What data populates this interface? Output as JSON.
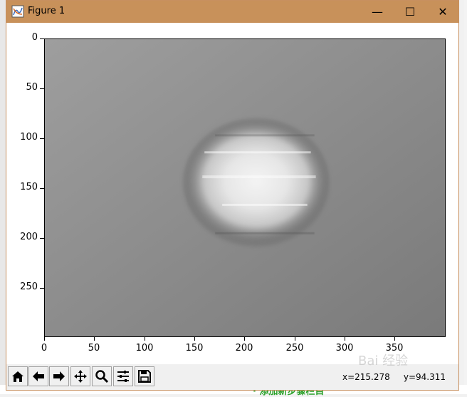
{
  "window": {
    "title": "Figure 1",
    "controls": {
      "minimize": "—",
      "maximize": "☐",
      "close": "✕"
    }
  },
  "plot": {
    "type": "image",
    "colormap": "grayscale",
    "y_ticks": [
      "0",
      "50",
      "100",
      "150",
      "200",
      "250"
    ],
    "x_ticks": [
      "0",
      "50",
      "100",
      "150",
      "200",
      "250",
      "300",
      "350"
    ]
  },
  "toolbar": {
    "buttons": [
      "home",
      "back",
      "forward",
      "pan",
      "zoom",
      "configure-subplots",
      "save"
    ],
    "coords": "x=215.278     y=94.311"
  },
  "background": {
    "bottom_text": "· 添加新步骤栏目"
  },
  "watermark": "Bai 经验"
}
